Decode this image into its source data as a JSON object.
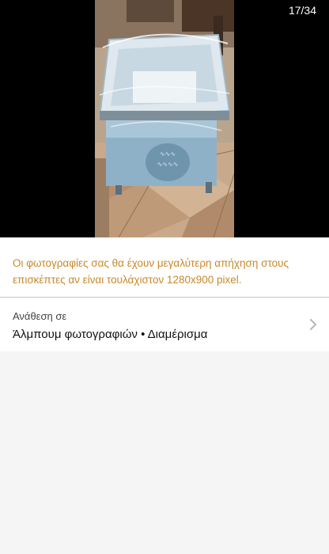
{
  "viewer": {
    "counter": "17/34",
    "photo_icon": "travel-cot-photo"
  },
  "notice": {
    "text": "Οι φωτογραφίες σας θα έχουν μεγαλύτερη απήχηση στους επισκέπτες αν είναι τουλάχιστον 1280x900 pixel.",
    "color": "#c8882a"
  },
  "album": {
    "label": "Ανάθεση σε",
    "value": "Άλμπουμ φωτογραφιών • Διαμέρισμα",
    "chevron_icon": "chevron-right-icon"
  }
}
